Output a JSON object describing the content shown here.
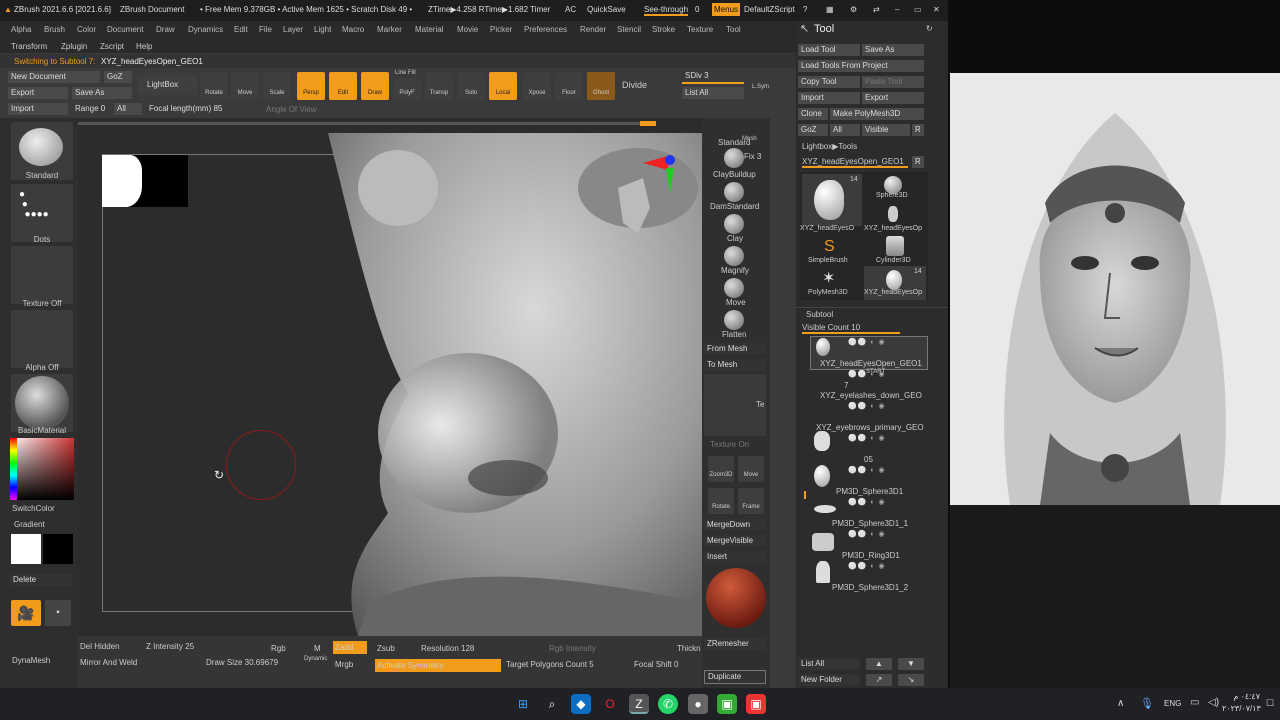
{
  "titlebar": {
    "app": "ZBrush 2021.6.6 [2021.6.6]",
    "doc": "ZBrush Document",
    "mem": "• Free Mem 9.378GB • Active Mem 1625 • Scratch Disk 49 •",
    "ztime": "ZTime▶4.258 RTime▶1.682 Timer",
    "ac": "AC",
    "quicksave": "QuickSave",
    "seethrough": "See-through",
    "seethrough_val": "0",
    "menus": "Menus",
    "script": "DefaultZScript"
  },
  "menu": [
    "Alpha",
    "Brush",
    "Color",
    "Document",
    "Draw",
    "Dynamics",
    "Edit",
    "File",
    "Layer",
    "Light",
    "Macro",
    "Marker",
    "Material",
    "Movie",
    "Picker",
    "Preferences",
    "Render",
    "Stencil",
    "Stroke",
    "Texture",
    "Tool"
  ],
  "menu2": [
    "Transform",
    "Zplugin",
    "Zscript",
    "Help"
  ],
  "notice": "Switching to Subtool 7:",
  "notice_name": "XYZ_headEyesOpen_GEO1",
  "left_top": {
    "new_doc": "New Document",
    "goz": "GoZ",
    "export": "Export",
    "save_as": "Save As",
    "import": "Import",
    "range": "Range 0",
    "all": "All",
    "lightbox": "LightBox",
    "focal": "Focal length(mm) 85",
    "angle": "Angle Of View"
  },
  "toolbar": [
    {
      "label": "Rotate",
      "on": false
    },
    {
      "label": "Move",
      "on": false
    },
    {
      "label": "Scale",
      "on": false
    },
    {
      "label": "Persp",
      "on": true
    },
    {
      "label": "Edit",
      "on": true
    },
    {
      "label": "Draw",
      "on": true
    },
    {
      "label": "PolyF",
      "on": false
    },
    {
      "label": "Transp",
      "on": false
    },
    {
      "label": "Solo",
      "on": false
    },
    {
      "label": "Local",
      "on": true
    },
    {
      "label": "Xpose",
      "on": false
    },
    {
      "label": "Floor",
      "on": false
    },
    {
      "label": "Ghost",
      "on": false
    }
  ],
  "linefill": "Line Fill",
  "divide": "Divide",
  "sdiv": "SDiv 3",
  "list_all": "List All",
  "ldym": "L.Sym",
  "left_panel": {
    "standard": "Standard",
    "dots": "Dots",
    "texture_off": "Texture Off",
    "alpha_off": "Alpha Off",
    "basic_material": "BasicMaterial",
    "switch_color": "SwitchColor",
    "gradient": "Gradient",
    "delete": "Delete",
    "dynamesh": "DynaMesh"
  },
  "brushes": [
    "Standard",
    "ClayBuildup",
    "DamStandard",
    "Clay",
    "Magnify",
    "Move",
    "Flatten"
  ],
  "brush_extra": {
    "mesh_label": "Mesh",
    "fix": "Fix 3"
  },
  "right_strip": {
    "from_mesh": "From Mesh",
    "to_mesh": "To Mesh",
    "te": "Te",
    "texture_on": "Texture On",
    "zoom3d": "Zoom3D",
    "move": "Move",
    "rotate": "Rotate",
    "frame": "Frame",
    "merge_down": "MergeDown",
    "merge_visible": "MergeVisible",
    "insert": "Insert",
    "zremesher": "ZRemesher",
    "duplicate": "Duplicate"
  },
  "bottom": {
    "del_hidden": "Del Hidden",
    "mirror_weld": "Mirror And Weld",
    "z_intensity": "Z Intensity 25",
    "draw_size": "Draw Size 30.69679",
    "dynamic": "Dynamic",
    "rgb": "Rgb",
    "m": "M",
    "zadd": "Zadd",
    "zsub": "Zsub",
    "mrgb": "Mrgb",
    "resolution": "Resolution 128",
    "activate_symmetry": "Activate Symmetry",
    "rgb_intensity": "Rgb Intensity",
    "target_poly": "Target Polygons Count 5",
    "thickn": "Thickn",
    "focal_shift": "Focal Shift 0"
  },
  "toolpanel": {
    "title": "Tool",
    "load_tool": "Load Tool",
    "save_as": "Save As",
    "load_project": "Load Tools From Project",
    "copy_tool": "Copy Tool",
    "paste_tool": "Paste Tool",
    "import": "Import",
    "export": "Export",
    "clone": "Clone",
    "make_polymesh": "Make PolyMesh3D",
    "goz": "GoZ",
    "all": "All",
    "visible": "Visible",
    "r": "R",
    "lightbox_tools": "Lightbox▶Tools",
    "current_tool": "XYZ_headEyesOpen_GEO1",
    "r2": "R",
    "tools": [
      {
        "name": "XYZ_headEyesO",
        "count": "14"
      },
      {
        "name": "Sphere3D",
        "count": ""
      },
      {
        "name": "",
        "count": ""
      },
      {
        "name": "XYZ_headEyesOp",
        "count": ""
      },
      {
        "name": "SimpleBrush",
        "count": ""
      },
      {
        "name": "Cylinder3D",
        "count": ""
      },
      {
        "name": "PolyMesh3D",
        "count": ""
      },
      {
        "name": "XYZ_headEyesOp",
        "count": "14"
      }
    ],
    "subtool": "Subtool",
    "visible_count": "Visible Count 10",
    "subtools": [
      "XYZ_headEyesOpen_GEO1",
      "XYZ_eyelashes_down_GEO",
      "XYZ_eyebrows_primary_GEO",
      "PM3D_Sphere3D1",
      "PM3D_Sphere3D1_1",
      "PM3D_Ring3D1",
      "PM3D_Sphere3D1_2"
    ],
    "start": "START",
    "seven": "7",
    "five": "05",
    "list_all": "List All",
    "new_folder": "New Folder"
  },
  "taskbar": {
    "lang": "ENG",
    "time": "٠٤:٤٧ م",
    "date": "٢٠٢٣/٠٧/١٣"
  },
  "colors": {
    "accent": "#f29c1c",
    "panel": "#2c2c2c",
    "button": "#4a4a4a"
  }
}
